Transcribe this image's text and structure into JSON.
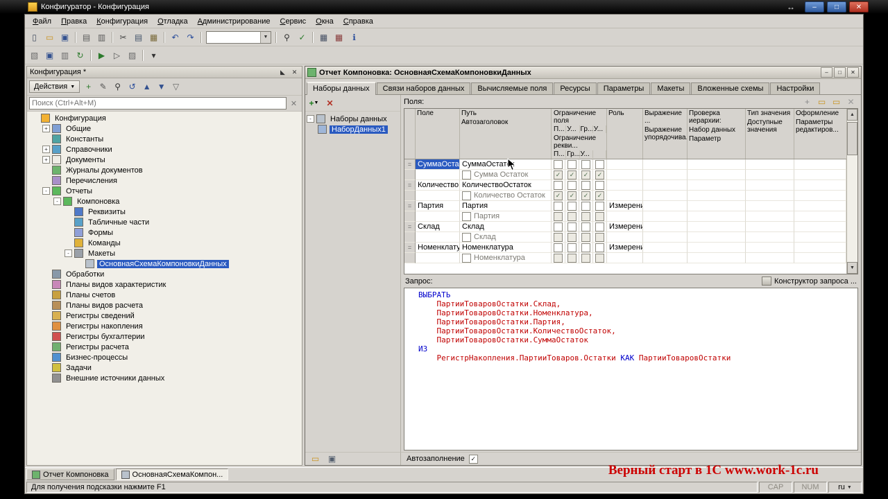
{
  "colors": {
    "selection": "#2a5ac0",
    "keyword": "#0000cc",
    "identifier": "#c00000",
    "watermark": "#cc0000"
  },
  "titlebar": {
    "title": "Конфигуратор - Конфигурация"
  },
  "menu": [
    "Файл",
    "Правка",
    "Конфигурация",
    "Отладка",
    "Администрирование",
    "Сервис",
    "Окна",
    "Справка"
  ],
  "toolbar1": [
    "new-document-icon",
    "open-icon",
    "save-icon",
    "|",
    "print-icon",
    "print-preview-icon",
    "|",
    "cut-icon",
    "copy-icon",
    "paste-icon",
    "|",
    "undo-icon",
    "redo-icon",
    "|",
    "combo",
    "|",
    "find-icon",
    "syntax-check-icon",
    "|",
    "calculator-icon",
    "calendar-icon",
    "info-icon"
  ],
  "toolbar2": [
    "open-configuration-icon",
    "save-configuration-icon",
    "compare-configurations-icon",
    "update-database-icon",
    "|",
    "start-debugging-icon",
    "attach-debugger-icon",
    "measure-icon",
    "|",
    "overflow-chevron-icon"
  ],
  "sidebar": {
    "title": "Конфигурация *",
    "actions_button": "Действия",
    "action_icons": [
      "add-icon",
      "edit-icon",
      "find-icon",
      "history-icon",
      "move-up-icon",
      "move-down-icon",
      "filter-icon"
    ],
    "search_placeholder": "Поиск (Ctrl+Alt+M)",
    "tree": [
      {
        "label": "Конфигурация",
        "level": 0,
        "icon": "configuration",
        "expand": ""
      },
      {
        "label": "Общие",
        "level": 1,
        "icon": "folder-common",
        "expand": "+"
      },
      {
        "label": "Константы",
        "level": 1,
        "icon": "constants",
        "expand": ""
      },
      {
        "label": "Справочники",
        "level": 1,
        "icon": "catalogs",
        "expand": "+"
      },
      {
        "label": "Документы",
        "level": 1,
        "icon": "documents",
        "expand": "+"
      },
      {
        "label": "Журналы документов",
        "level": 1,
        "icon": "journals",
        "expand": ""
      },
      {
        "label": "Перечисления",
        "level": 1,
        "icon": "enums",
        "expand": ""
      },
      {
        "label": "Отчеты",
        "level": 1,
        "icon": "reports",
        "expand": "-"
      },
      {
        "label": "Компоновка",
        "level": 2,
        "icon": "report",
        "expand": "-"
      },
      {
        "label": "Реквизиты",
        "level": 3,
        "icon": "attributes",
        "expand": ""
      },
      {
        "label": "Табличные части",
        "level": 3,
        "icon": "tabular-sections",
        "expand": ""
      },
      {
        "label": "Формы",
        "level": 3,
        "icon": "forms",
        "expand": ""
      },
      {
        "label": "Команды",
        "level": 3,
        "icon": "commands",
        "expand": ""
      },
      {
        "label": "Макеты",
        "level": 3,
        "icon": "templates",
        "expand": "-"
      },
      {
        "label": "ОсновнаяСхемаКомпоновкиДанных",
        "level": 4,
        "icon": "dcs-template",
        "expand": "",
        "selected": true
      },
      {
        "label": "Обработки",
        "level": 1,
        "icon": "data-processors",
        "expand": ""
      },
      {
        "label": "Планы видов характеристик",
        "level": 1,
        "icon": "chart-of-characteristic-types",
        "expand": ""
      },
      {
        "label": "Планы счетов",
        "level": 1,
        "icon": "chart-of-accounts",
        "expand": ""
      },
      {
        "label": "Планы видов расчета",
        "level": 1,
        "icon": "chart-of-calculation-types",
        "expand": ""
      },
      {
        "label": "Регистры сведений",
        "level": 1,
        "icon": "information-registers",
        "expand": ""
      },
      {
        "label": "Регистры накопления",
        "level": 1,
        "icon": "accumulation-registers",
        "expand": ""
      },
      {
        "label": "Регистры бухгалтерии",
        "level": 1,
        "icon": "accounting-registers",
        "expand": ""
      },
      {
        "label": "Регистры расчета",
        "level": 1,
        "icon": "calculation-registers",
        "expand": ""
      },
      {
        "label": "Бизнес-процессы",
        "level": 1,
        "icon": "business-processes",
        "expand": ""
      },
      {
        "label": "Задачи",
        "level": 1,
        "icon": "tasks",
        "expand": ""
      },
      {
        "label": "Внешние источники данных",
        "level": 1,
        "icon": "external-data-sources",
        "expand": ""
      }
    ]
  },
  "doc": {
    "title": "Отчет Компоновка: ОсновнаяСхемаКомпоновкиДанных",
    "tabs": [
      "Наборы данных",
      "Связи наборов данных",
      "Вычисляемые поля",
      "Ресурсы",
      "Параметры",
      "Макеты",
      "Вложенные схемы",
      "Настройки"
    ],
    "active_tab": "Наборы данных",
    "datasets": {
      "root": "Наборы данных",
      "items": [
        {
          "label": "НаборДанных1",
          "selected": true
        }
      ]
    },
    "fields": {
      "label": "Поля:",
      "toolbar_icons": [
        "add-field-icon",
        "open-folder-icon",
        "new-folder-icon",
        "delete-field-icon"
      ],
      "header": {
        "field": "Поле",
        "path": "Путь",
        "path_sub": "Автозаголовок",
        "restrict": "Ограничение поля",
        "restrict_cols": [
          "П...",
          "У...",
          "Гр...",
          "У..."
        ],
        "restrict2": "Ограничение рекви...",
        "restrict2_cols": [
          "П...",
          "Гр...",
          "У..."
        ],
        "role": "Роль",
        "expr": "Выражение ...",
        "expr_sub": "Выражение упорядочива...",
        "hierarchy": "Проверка иерархии:",
        "hierarchy_sub1": "Набор данных",
        "hierarchy_sub2": "Параметр",
        "type": "Тип значения",
        "type_sub": "Доступные значения",
        "format": "Оформление",
        "format_sub": "Параметры редактиров..."
      },
      "rows": [
        {
          "field": "СуммаОста...",
          "field_selected": true,
          "path": "СуммаОстаток",
          "auto_title": "Сумма Остаток",
          "role": "",
          "sub_checked": true
        },
        {
          "field": "Количество...",
          "field_selected": false,
          "path": "КоличествоОстаток",
          "auto_title": "Количество Остаток",
          "role": "",
          "sub_checked": true
        },
        {
          "field": "Партия",
          "field_selected": false,
          "path": "Партия",
          "auto_title": "Партия",
          "role": "Измерение",
          "sub_checked": false
        },
        {
          "field": "Склад",
          "field_selected": false,
          "path": "Склад",
          "auto_title": "Склад",
          "role": "Измерение",
          "sub_checked": false
        },
        {
          "field": "Номенклату...",
          "field_selected": false,
          "path": "Номенклатура",
          "auto_title": "Номенклатура",
          "role": "Измерение",
          "sub_checked": false
        }
      ]
    },
    "query": {
      "label": "Запрос:",
      "builder_button": "Конструктор запроса ...",
      "lines": [
        [
          {
            "t": "ВЫБРАТЬ",
            "c": "kw"
          }
        ],
        [
          {
            "t": "    ПартииТоваровОстатки.Склад,",
            "c": "id"
          }
        ],
        [
          {
            "t": "    ПартииТоваровОстатки.Номенклатура,",
            "c": "id"
          }
        ],
        [
          {
            "t": "    ПартииТоваровОстатки.Партия,",
            "c": "id"
          }
        ],
        [
          {
            "t": "    ПартииТоваровОстатки.КоличествоОстаток,",
            "c": "id"
          }
        ],
        [
          {
            "t": "    ПартииТоваровОстатки.СуммаОстаток",
            "c": "id"
          }
        ],
        [
          {
            "t": "ИЗ",
            "c": "kw"
          }
        ],
        [
          {
            "t": "    РегистрНакопления.ПартииТоваров.Остатки ",
            "c": "id"
          },
          {
            "t": "КАК",
            "c": "kw"
          },
          {
            "t": " ПартииТоваровОстатки",
            "c": "id"
          }
        ]
      ]
    },
    "bottom_icons": [
      "folder-icon",
      "save-small-icon"
    ],
    "autofill_label": "Автозаполнение",
    "autofill_checked": true
  },
  "wintabs": [
    {
      "label": "Отчет Компоновка",
      "active": false
    },
    {
      "label": "ОсновнаяСхемаКомпон...",
      "active": true
    }
  ],
  "statusbar": {
    "hint": "Для получения подсказки нажмите F1",
    "indicators": [
      "CAP",
      "NUM",
      "ru"
    ]
  },
  "watermark": "Верный старт в 1С www.work-1c.ru"
}
